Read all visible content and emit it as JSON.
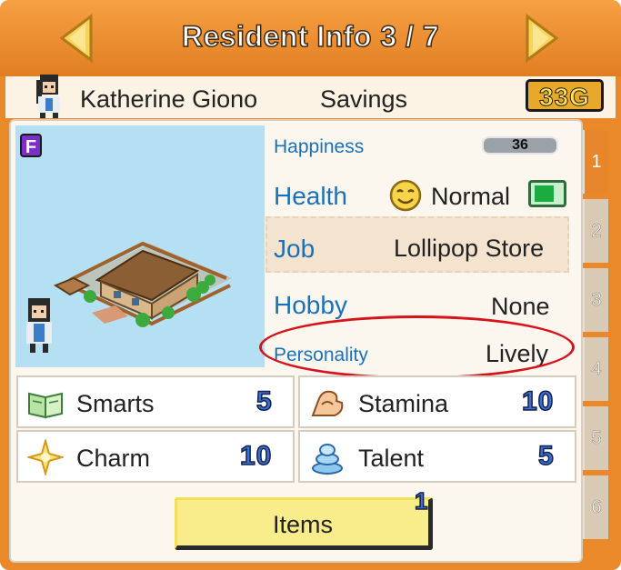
{
  "header": {
    "title": "Resident Info 3 / 7",
    "prev_icon": "left-arrow-icon",
    "next_icon": "right-arrow-icon"
  },
  "resident": {
    "name": "Katherine Giono",
    "savings_label": "Savings",
    "savings_value": "33G",
    "rank": "F"
  },
  "info": {
    "happiness": {
      "label": "Happiness",
      "value": "36"
    },
    "health": {
      "label": "Health",
      "value": "Normal",
      "icon": "smiley-face-icon",
      "battery_level": 0.75
    },
    "job": {
      "label": "Job",
      "value": "Lollipop Store"
    },
    "hobby": {
      "label": "Hobby",
      "value": "None"
    },
    "personality": {
      "label": "Personality",
      "value": "Lively"
    }
  },
  "stats": [
    {
      "label": "Smarts",
      "value": "5",
      "icon": "book-icon"
    },
    {
      "label": "Stamina",
      "value": "10",
      "icon": "muscle-arm-icon"
    },
    {
      "label": "Charm",
      "value": "10",
      "icon": "sparkle-icon"
    },
    {
      "label": "Talent",
      "value": "5",
      "icon": "talent-swirl-icon"
    }
  ],
  "items": {
    "label": "Items",
    "count": "1"
  },
  "page_tabs": [
    "1",
    "2",
    "3",
    "4",
    "5",
    "6"
  ],
  "colors": {
    "frame": "#e9892a",
    "label_blue": "#1c70b8",
    "highlight_red": "#d8121b",
    "stat_blue": "#3c6fd4"
  }
}
